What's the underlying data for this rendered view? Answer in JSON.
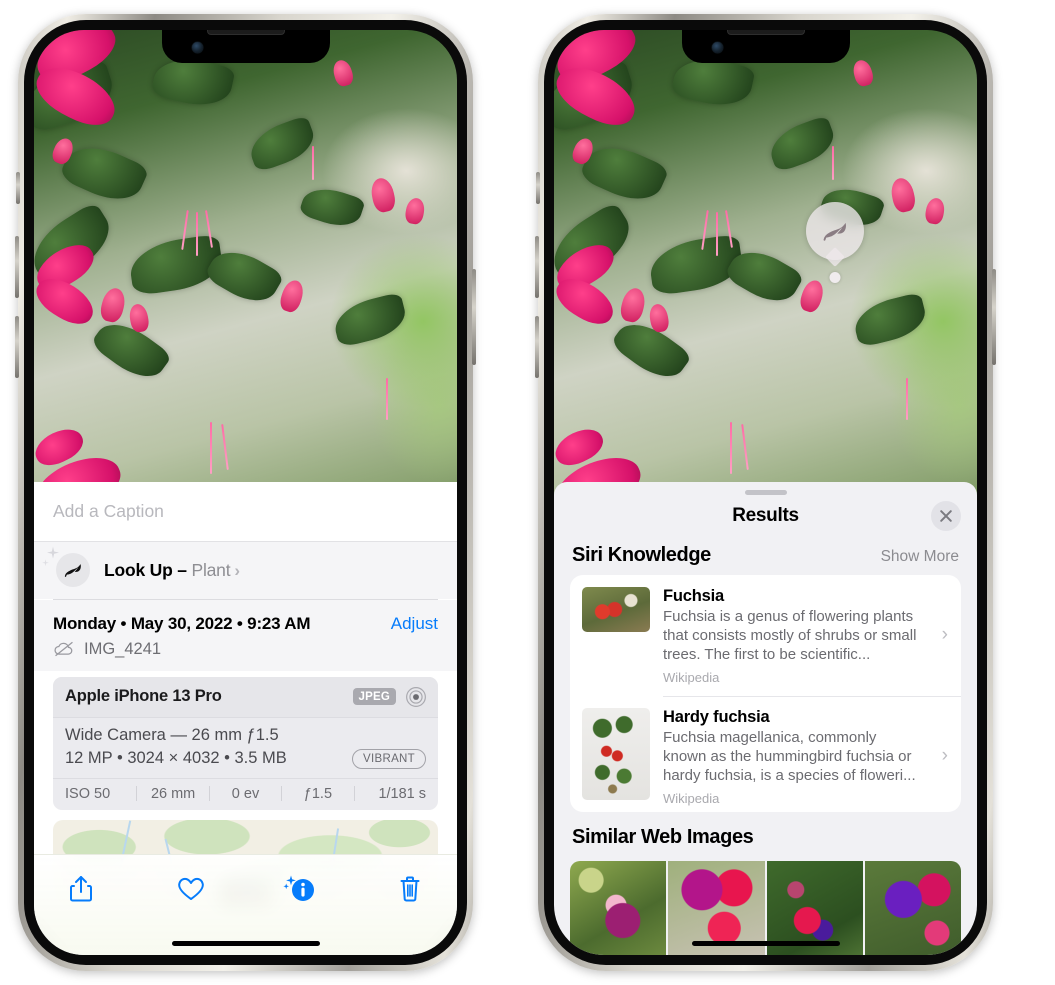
{
  "left_phone": {
    "name": "photo-detail-view",
    "caption_placeholder": "Add a Caption",
    "lookup": {
      "label": "Look Up",
      "dash": "–",
      "subject": "Plant",
      "chevron": "›",
      "icon": "leaf-icon",
      "sparkle_icon": "sparkle-icon"
    },
    "date": "Monday • May 30, 2022 • 9:23 AM",
    "adjust_label": "Adjust",
    "file_name": "IMG_4241",
    "cloud_icon": "icloud-slash-icon",
    "exif": {
      "device": "Apple iPhone 13 Pro",
      "format_badge": "JPEG",
      "hdr_icon": "hdr-circles-icon",
      "lens_line": "Wide Camera — 26 mm ƒ1.5",
      "size_line": "12 MP • 3024 × 4032 • 3.5 MB",
      "style_pill": "VIBRANT",
      "stats": [
        "ISO 50",
        "26 mm",
        "0 ev",
        "ƒ1.5",
        "1/181 s"
      ]
    },
    "toolbar": {
      "share_label": "share-icon",
      "favorite_label": "heart-icon",
      "info_label": "info-sparkle-icon",
      "delete_label": "trash-icon"
    },
    "accent_blue": "#067CFB"
  },
  "right_phone": {
    "name": "visual-lookup-results",
    "badge_icon": "leaf-icon",
    "results_title": "Results",
    "close_icon": "close-icon",
    "grabber": "sheet-grabber",
    "siri_section": {
      "title": "Siri Knowledge",
      "show_more": "Show More",
      "items": [
        {
          "title": "Fuchsia",
          "description": "Fuchsia is a genus of flowering plants that consists mostly of shrubs or small trees. The first to be scientific...",
          "source": "Wikipedia",
          "chevron": "›"
        },
        {
          "title": "Hardy fuchsia",
          "description": "Fuchsia magellanica, commonly known as the hummingbird fuchsia or hardy fuchsia, is a species of floweri...",
          "source": "Wikipedia",
          "chevron": "›"
        }
      ]
    },
    "web_section": {
      "title": "Similar Web Images",
      "images": [
        "web-image-1",
        "web-image-2",
        "web-image-3",
        "web-image-4"
      ]
    }
  }
}
